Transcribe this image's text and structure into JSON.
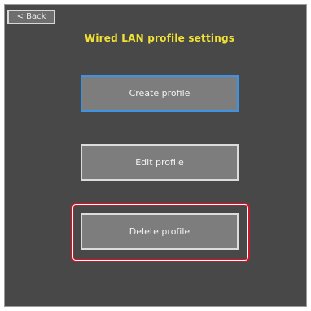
{
  "header": {
    "back_label": "< Back",
    "title": "Wired LAN profile settings"
  },
  "menu": {
    "create_label": "Create profile",
    "edit_label": "Edit profile",
    "delete_label": "Delete profile"
  },
  "colors": {
    "background": "#484848",
    "title": "#f2e234",
    "button_fill": "#7d7d7d",
    "focus_border": "#3f93e4",
    "highlight": "#c8192b"
  }
}
